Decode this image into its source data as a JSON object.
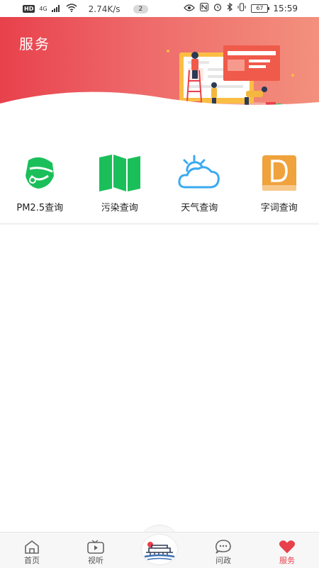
{
  "status_bar": {
    "hd": "HD",
    "signal": "4G",
    "speed": "2.74K/s",
    "badge": "2",
    "battery": "67",
    "time": "15:59"
  },
  "header": {
    "title": "服务"
  },
  "services": [
    {
      "label": "PM2.5查询",
      "icon": "mask-icon",
      "color": "#1bbf5a"
    },
    {
      "label": "污染查询",
      "icon": "map-icon",
      "color": "#1bbf5a"
    },
    {
      "label": "天气查询",
      "icon": "weather-cloud-icon",
      "color": "#3aaaf0"
    },
    {
      "label": "字词查询",
      "icon": "dictionary-icon",
      "color": "#f0a23c"
    }
  ],
  "bottom_nav": {
    "items": [
      {
        "label": "首页",
        "icon": "home-icon"
      },
      {
        "label": "视听",
        "icon": "video-icon"
      },
      {
        "label": "问政",
        "icon": "chat-icon"
      },
      {
        "label": "服务",
        "icon": "heart-icon",
        "active": true
      }
    ],
    "center_icon": "city-logo-icon"
  },
  "colors": {
    "accent": "#e8414c",
    "banner_start": "#e8414c",
    "banner_end": "#f3907d"
  }
}
